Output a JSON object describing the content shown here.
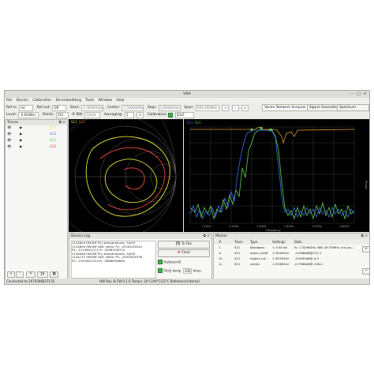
{
  "window": {
    "title": "VNA"
  },
  "menu": [
    "File",
    "Device",
    "Calibration",
    "De-embedding",
    "Tools",
    "Window",
    "Help"
  ],
  "toolbar1": {
    "ref_in_label": "Ref in:",
    "ref_in_value": "Int",
    "ref_out_label": "Ref out:",
    "ref_out_value": "Off",
    "start_label": "Start:",
    "start_value": "1.00000GHz",
    "center_label": "Center:",
    "center_value": "1.50000GHz",
    "stop_label": "Stop:",
    "stop_value": "1.60000GHz",
    "span_label": "Span:",
    "span_value": "600.000MHz"
  },
  "modes": [
    "Vector Network Analyzer",
    "Signal Generator",
    "Spectrum Analyzer"
  ],
  "toolbar2": {
    "level_label": "Level:",
    "level_value": "-0.00dBm",
    "points_label": "Points:",
    "points_value": "501",
    "ifbw_label": "IF BW:",
    "ifbw_value": "10kHz",
    "averaging_label": "Averaging:",
    "averaging_value": "1",
    "calibration_label": "Calibration:",
    "calibration_value": "SOLT"
  },
  "traces": {
    "title": "Traces",
    "items": [
      {
        "name": "S11",
        "color": "#e8e03a"
      },
      {
        "name": "S12",
        "color": "#3a6ee8"
      },
      {
        "name": "S21",
        "color": "#5fd04a"
      },
      {
        "name": "S22",
        "color": "#e84a3a"
      }
    ],
    "buttons": [
      "+",
      "-",
      "Edit",
      "Math",
      "Expand"
    ]
  },
  "smith": {
    "legend": [
      "S11",
      "S22"
    ]
  },
  "plot": {
    "legend": [
      "S12",
      "S21"
    ],
    "xlabel": "Frequency",
    "ylabel": "Phase",
    "xticks": [
      "1.1GHz",
      "1.2GHz",
      "1.3GHz",
      "1.4GHz",
      "1.5GHz",
      "1.6GHz"
    ]
  },
  "device_log": {
    "title": "Device Log",
    "lines": [
      "1124604  HW:INF  PLL temperatures: 34/49",
      "1124604  HW:INF  ADC limits: P1: -20162/20241",
      "P2: -21146/21172 R: -20583/28714",
      "1126408  HW:INF  PLL temperatures: 34/49",
      "1144711  HW:INF  ADC limits: P1: -20529/20339",
      "P2: -21016/21124 R: -28668/28609"
    ],
    "to_file": "To File",
    "clear": "Clear",
    "autoscroll": "Autoscroll",
    "only_keep": "Only keep",
    "keep_value": "200",
    "lines_label": "lines"
  },
  "marker": {
    "title": "Marker",
    "headers": [
      "#",
      "Trace",
      "Type",
      "Settings",
      "Data"
    ],
    "rows": [
      {
        "num": "1",
        "trace": "S21",
        "type": "Bandpass",
        "settings": "< 3.00 db",
        "data": "fc: 1.3296GHz, BW: 49.35MHz, Ins.Los..."
      },
      {
        "num": "1l",
        "trace": "S21",
        "type": "lower cutoff",
        "settings": "1.3049GHz",
        "data": "-3.0988dB@172.1"
      },
      {
        "num": "1h",
        "trace": "S21",
        "type": "higher cut...",
        "settings": "1.3533GHz",
        "data": "-3.0490dB@-4.0"
      },
      {
        "num": "1c",
        "trace": "S21",
        "type": "center",
        "settings": "1.3296GHz",
        "data": "-0.7966dB@-106.4"
      }
    ]
  },
  "status": {
    "left": "Connected to 2070396837135",
    "right": "HW Rev.:B FW:0.1.0 Temps: 34°C/49°C/23°C Reference:Internal"
  }
}
